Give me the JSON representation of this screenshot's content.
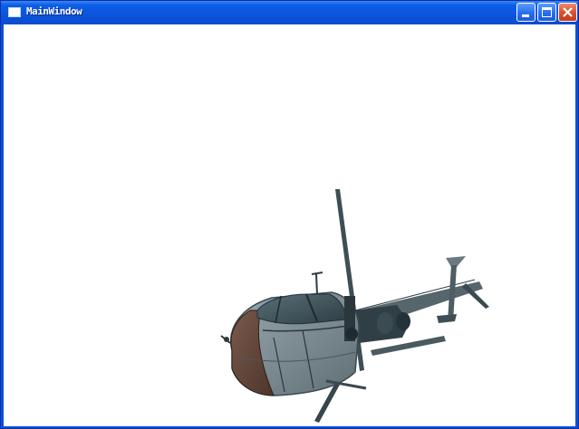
{
  "window": {
    "title": "MainWindow",
    "minimize_label": "",
    "maximize_label": "",
    "close_label": ""
  },
  "colors": {
    "titlebar": "#0a54dc",
    "close_button": "#d8502c",
    "viewport_background": "#ffffff"
  },
  "icons": {
    "app": "window-app-icon",
    "minimize": "minimize-icon",
    "maximize": "maximize-icon",
    "close": "close-icon"
  },
  "viewport": {
    "content": "3d-helicopter-model"
  }
}
